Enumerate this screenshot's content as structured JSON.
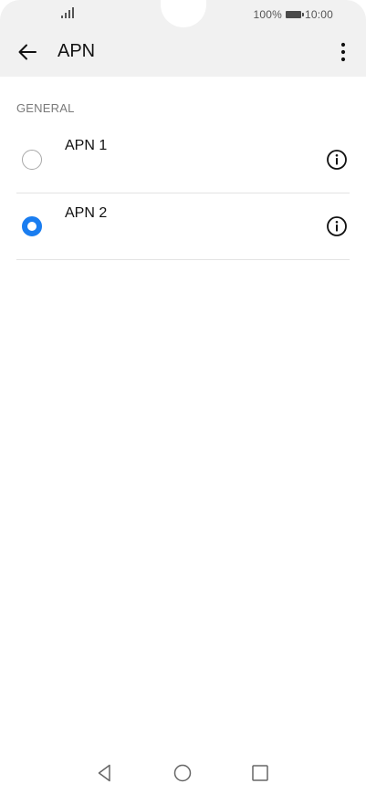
{
  "status_bar": {
    "battery_percent": "100%",
    "time": "10:00",
    "icons": [
      "signal-icon",
      "battery-icon"
    ]
  },
  "header": {
    "title": "APN",
    "icons": [
      "back-arrow-icon",
      "more-vert-icon"
    ]
  },
  "section": {
    "header": "GENERAL"
  },
  "apns": [
    {
      "label": "APN 1",
      "selected": false
    },
    {
      "label": "APN 2",
      "selected": true
    }
  ],
  "nav_bar": {
    "icons": [
      "nav-back-icon",
      "nav-home-icon",
      "nav-recents-icon"
    ]
  },
  "colors": {
    "accent": "#1a7df0",
    "topbar_bg": "#f1f1f1",
    "section_text": "#7a7a7a",
    "divider": "#e3e3e3"
  }
}
